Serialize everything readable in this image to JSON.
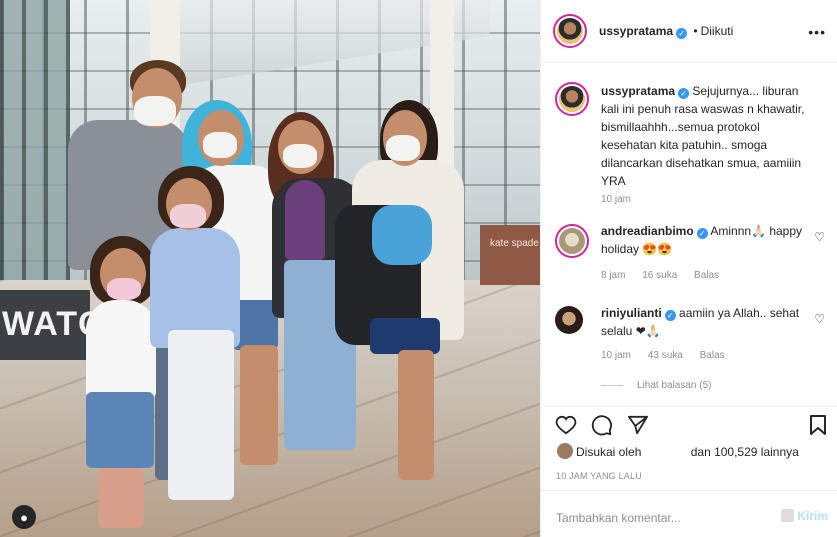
{
  "post": {
    "author": "ussypratama",
    "follow_status": "Diikuti",
    "more_label": "•••",
    "caption": "Sejujurnya... liburan kali ini penuh rasa waswas n khawatir, bismillaahhh...semua protokol kesehatan kita patuhin.. smoga dilancarkan disehatkan smua, aamiiin YRA",
    "caption_time": "10 jam",
    "photo_sign_text": "WATC",
    "photo_kiosk_text": "kate spade"
  },
  "comments": [
    {
      "username": "andreadianbimo",
      "text": "Aminnn🙏🏻 happy holiday 😍😍",
      "time": "8 jam",
      "likes": "16 suka",
      "reply": "Balas"
    },
    {
      "username": "riniyulianti",
      "text": "aamiin ya Allah.. sehat selalu ❤🙏🏻",
      "time": "10 jam",
      "likes": "43 suka",
      "reply": "Balas",
      "view_replies": "Lihat balasan (5)"
    }
  ],
  "actions": {
    "liked_by_prefix": "Disukai oleh",
    "liked_by_suffix": "dan 100,529 lainnya",
    "time_ago": "10 JAM YANG LALU"
  },
  "add_comment": {
    "placeholder": "Tambahkan komentar...",
    "send_label": "Kirim"
  },
  "icons": {
    "heart": "heart-icon",
    "comment": "comment-icon",
    "share": "share-icon",
    "save": "bookmark-icon"
  }
}
